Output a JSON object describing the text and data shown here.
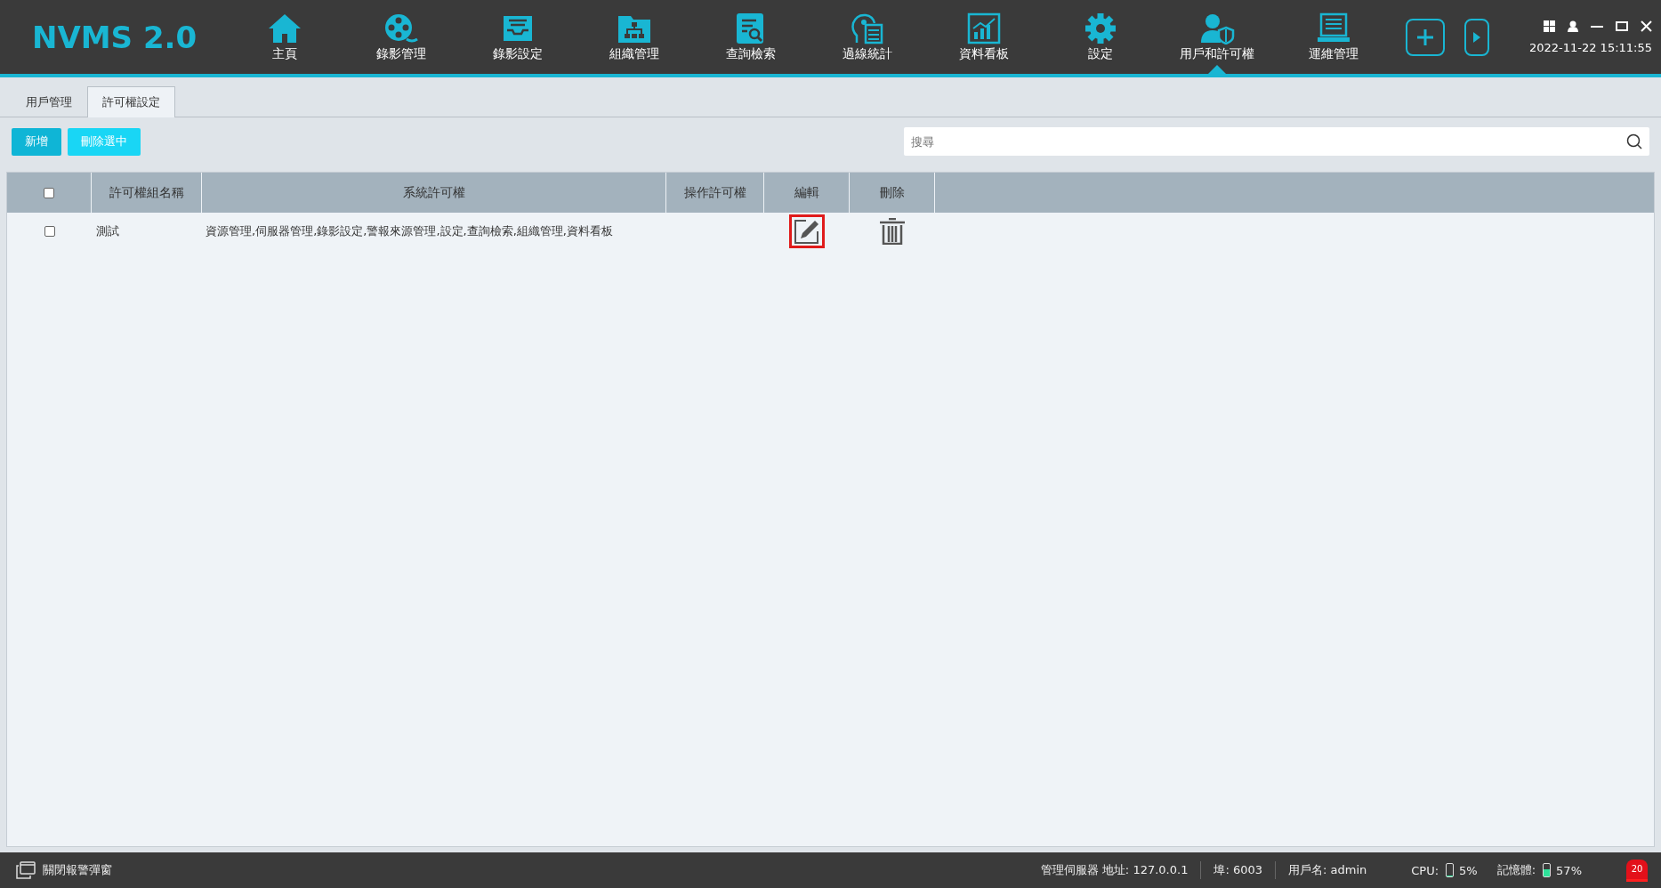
{
  "header": {
    "logo": "NVMS 2.0",
    "datetime": "2022-11-22 15:11:55"
  },
  "nav": [
    {
      "label": "主頁",
      "selected": false
    },
    {
      "label": "錄影管理",
      "selected": false
    },
    {
      "label": "錄影設定",
      "selected": false
    },
    {
      "label": "組織管理",
      "selected": false
    },
    {
      "label": "查詢檢索",
      "selected": false
    },
    {
      "label": "過線統計",
      "selected": false
    },
    {
      "label": "資料看板",
      "selected": false
    },
    {
      "label": "設定",
      "selected": false
    },
    {
      "label": "用戶和許可權",
      "selected": true
    },
    {
      "label": "運維管理",
      "selected": false
    }
  ],
  "tabs": [
    {
      "label": "用戶管理",
      "selected": false
    },
    {
      "label": "許可權設定",
      "selected": true
    }
  ],
  "toolbar": {
    "buttons": [
      {
        "label": "新增",
        "kind": "primary"
      },
      {
        "label": "刪除選中",
        "kind": "secondary"
      }
    ],
    "search": {
      "placeholder": "搜尋"
    }
  },
  "table": {
    "select_all_checked": false,
    "columns": [
      "許可權組名稱",
      "系統許可權",
      "操作許可權",
      "編輯",
      "刪除"
    ],
    "rows": [
      {
        "checked": false,
        "name": "測試",
        "system_permissions": "資源管理,伺服器管理,錄影設定,警報來源管理,設定,查詢檢索,組織管理,資料看板",
        "edit_highlighted": true
      }
    ]
  },
  "status_bar": {
    "alarm_popup": "關閉報警彈窗",
    "server": "管理伺服器 地址: 127.0.0.1",
    "port": "埠: 6003",
    "user": "用戶名: admin",
    "cpu_label": "CPU:",
    "cpu": {
      "level": 0.05,
      "reading": "5%"
    },
    "memory_label": "記憶體:",
    "memory": {
      "level": 0.57,
      "reading": "57%"
    },
    "alarm_count": "20"
  }
}
